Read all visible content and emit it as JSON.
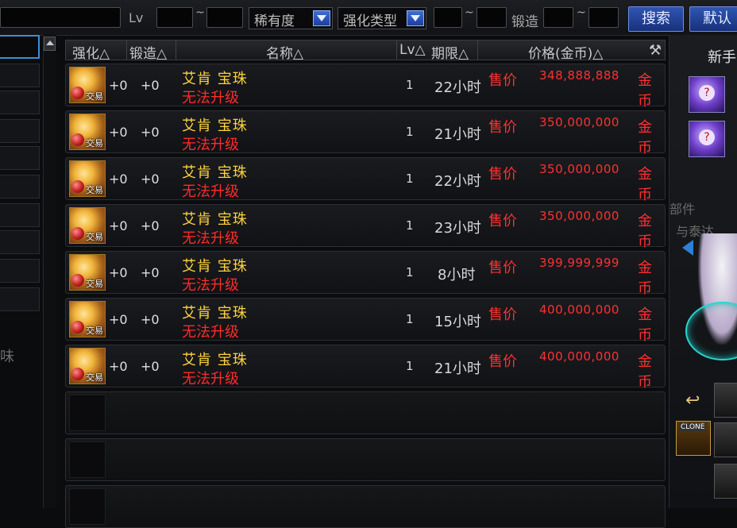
{
  "filter": {
    "lv_label": "Lv",
    "tilde": "~",
    "rarity_label": "稀有度",
    "enhance_type_label": "强化类型",
    "forge_label": "锻造",
    "search_button": "搜索",
    "default_button": "默认"
  },
  "left_panel": {
    "faded_text": "味"
  },
  "table": {
    "headers": {
      "enhance": "强化△",
      "forge": "锻造△",
      "name": "名称△",
      "lv": "Lv△",
      "duration": "期限△",
      "price": "价格(金币)△"
    },
    "rows": [
      {
        "icon_tag": "交易",
        "enhance": "+0",
        "forge": "+0",
        "name": "艾肯 宝珠",
        "status": "无法升级",
        "lv": "1",
        "duration": "22小时",
        "price_label": "售价",
        "price": "348,888,888",
        "currency": "金币"
      },
      {
        "icon_tag": "交易",
        "enhance": "+0",
        "forge": "+0",
        "name": "艾肯 宝珠",
        "status": "无法升级",
        "lv": "1",
        "duration": "21小时",
        "price_label": "售价",
        "price": "350,000,000",
        "currency": "金币"
      },
      {
        "icon_tag": "交易",
        "enhance": "+0",
        "forge": "+0",
        "name": "艾肯 宝珠",
        "status": "无法升级",
        "lv": "1",
        "duration": "22小时",
        "price_label": "售价",
        "price": "350,000,000",
        "currency": "金币"
      },
      {
        "icon_tag": "交易",
        "enhance": "+0",
        "forge": "+0",
        "name": "艾肯 宝珠",
        "status": "无法升级",
        "lv": "1",
        "duration": "23小时",
        "price_label": "售价",
        "price": "350,000,000",
        "currency": "金币"
      },
      {
        "icon_tag": "交易",
        "enhance": "+0",
        "forge": "+0",
        "name": "艾肯 宝珠",
        "status": "无法升级",
        "lv": "1",
        "duration": "8小时",
        "price_label": "售价",
        "price": "399,999,999",
        "currency": "金币"
      },
      {
        "icon_tag": "交易",
        "enhance": "+0",
        "forge": "+0",
        "name": "艾肯 宝珠",
        "status": "无法升级",
        "lv": "1",
        "duration": "15小时",
        "price_label": "售价",
        "price": "400,000,000",
        "currency": "金币"
      },
      {
        "icon_tag": "交易",
        "enhance": "+0",
        "forge": "+0",
        "name": "艾肯 宝珠",
        "status": "无法升级",
        "lv": "1",
        "duration": "21小时",
        "price_label": "售价",
        "price": "400,000,000",
        "currency": "金币"
      }
    ]
  },
  "right_panel": {
    "title": "新手",
    "faded_1": "部件",
    "faded_2": "与泰达",
    "clone_label": "CLONE"
  }
}
